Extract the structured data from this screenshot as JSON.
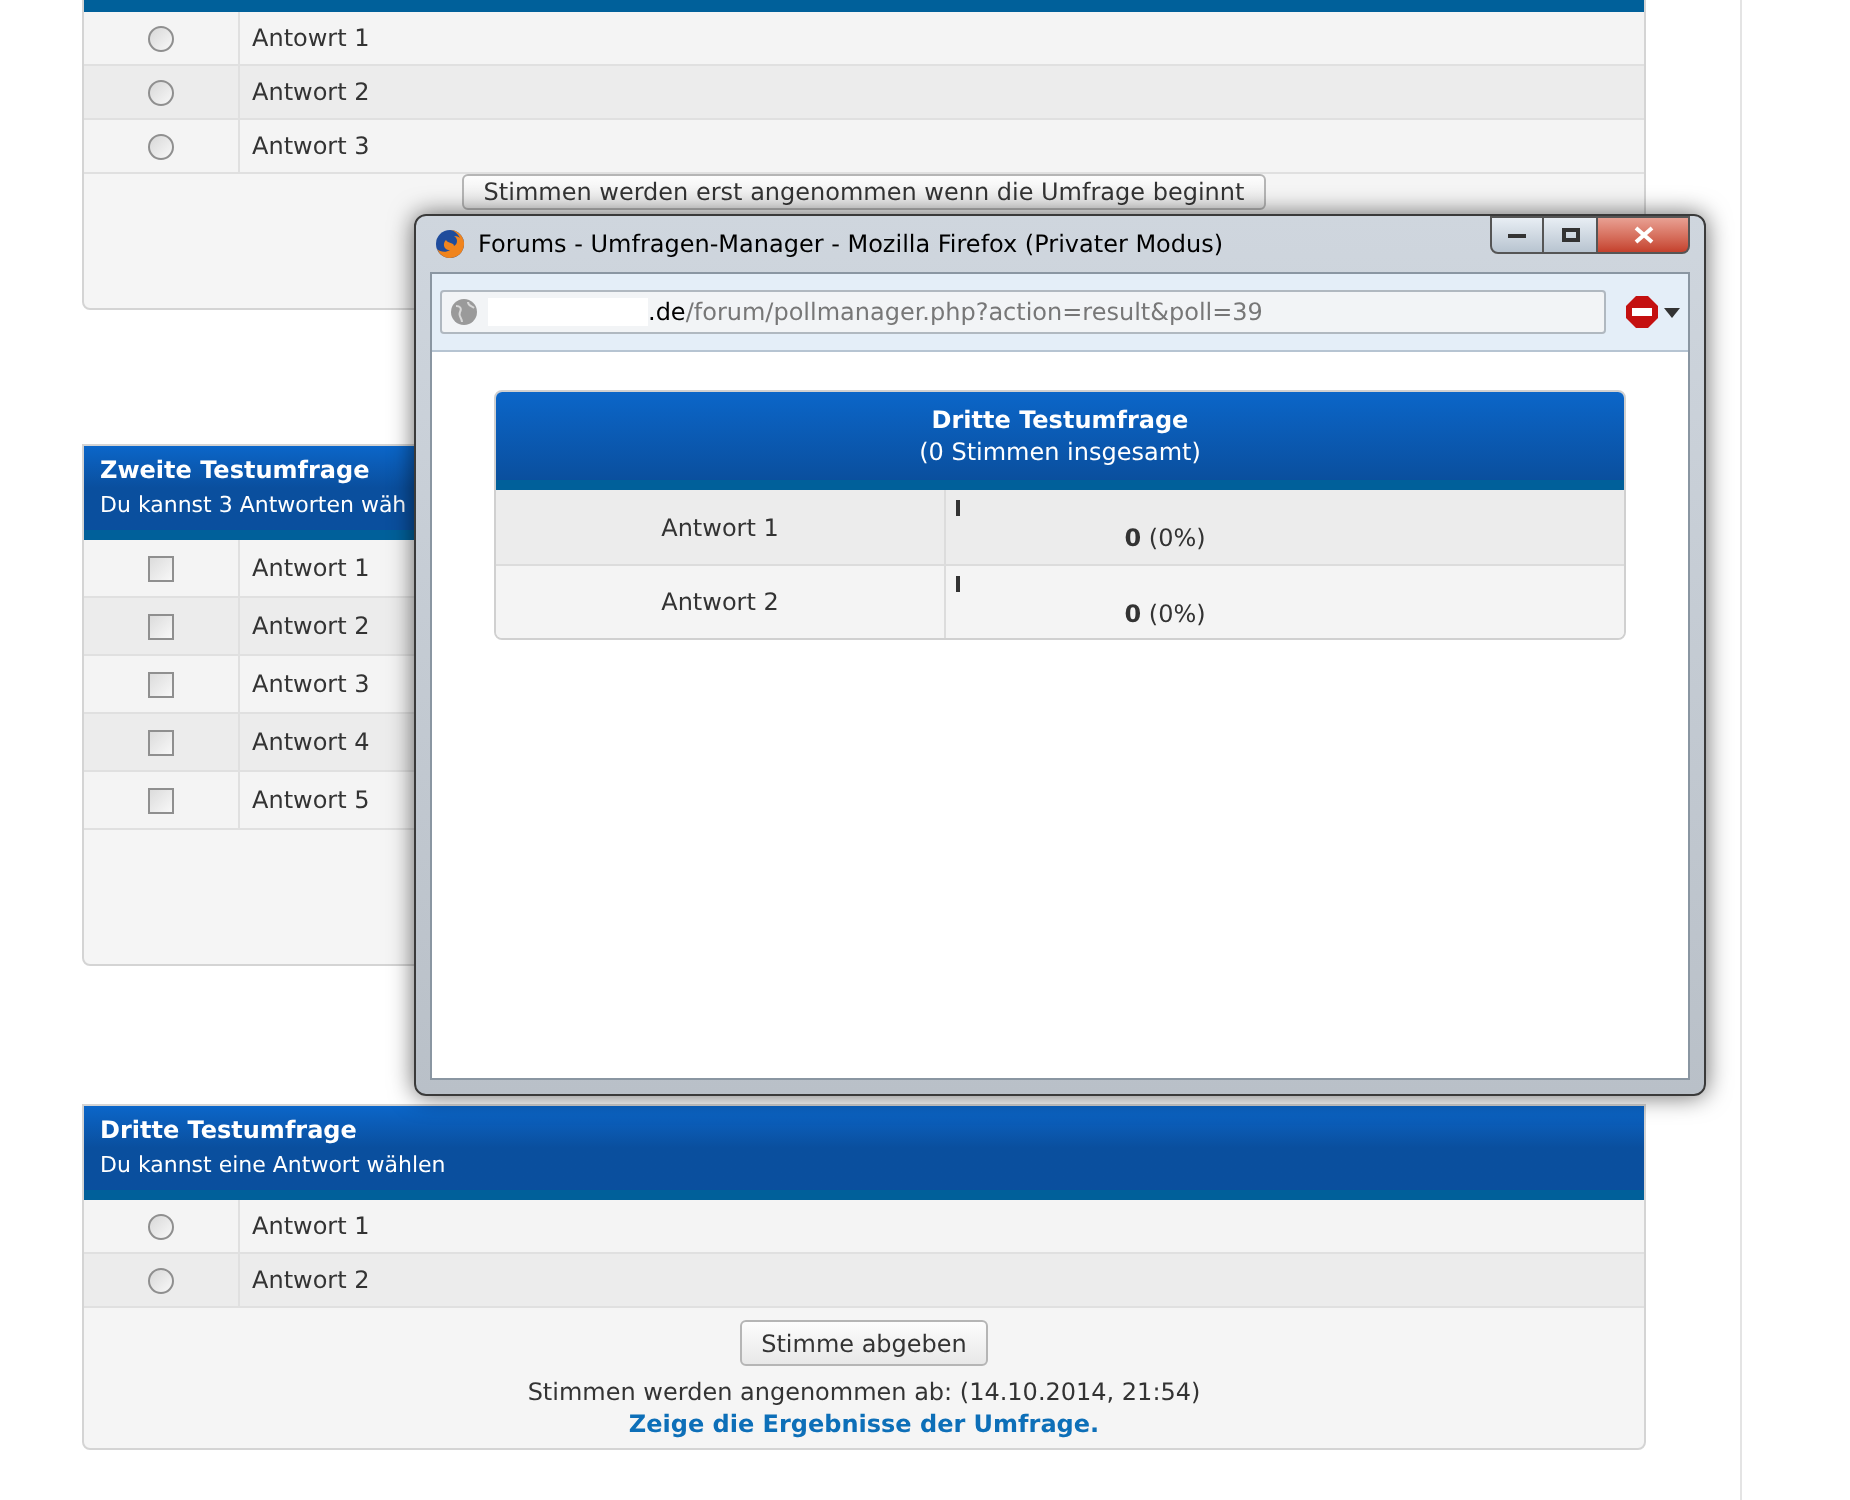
{
  "polls": [
    {
      "kind": "radio",
      "options": [
        {
          "label": "Antowrt 1",
          "selected": false
        },
        {
          "label": "Antwort 2",
          "selected": false
        },
        {
          "label": "Antwort 3",
          "selected": false
        }
      ],
      "footer": {
        "button": "Stimmen werden erst angenommen wenn die Umfrage beginnt"
      }
    },
    {
      "title": "Zweite Testumfrage",
      "subtitle": "Du kannst 3 Antworten wäh",
      "kind": "checkbox",
      "options": [
        {
          "label": "Antwort 1",
          "checked": false
        },
        {
          "label": "Antwort 2",
          "checked": false
        },
        {
          "label": "Antwort 3",
          "checked": false
        },
        {
          "label": "Antwort 4",
          "checked": false
        },
        {
          "label": "Antwort 5",
          "checked": false
        }
      ]
    },
    {
      "title": "Dritte Testumfrage",
      "subtitle": "Du kannst eine Antwort wählen",
      "kind": "radio",
      "options": [
        {
          "label": "Antwort 1",
          "selected": false
        },
        {
          "label": "Antwort 2",
          "selected": false
        }
      ],
      "footer": {
        "button": "Stimme abgeben",
        "note": "Stimmen werden angenommen ab: (14.10.2014, 21:54)",
        "link": "Zeige die Ergebnisse der Umfrage."
      }
    }
  ],
  "popup": {
    "title": "Forums - Umfragen-Manager - Mozilla Firefox (Privater Modus)",
    "url_host": ".de",
    "url_path": "/forum/pollmanager.php?action=result&poll=39",
    "results": {
      "title": "Dritte Testumfrage",
      "subtitle": "(0 Stimmen insgesamt)",
      "rows": [
        {
          "answer": "Antwort 1",
          "count": "0",
          "percent": "(0%)"
        },
        {
          "answer": "Antwort 2",
          "count": "0",
          "percent": "(0%)"
        }
      ]
    }
  }
}
